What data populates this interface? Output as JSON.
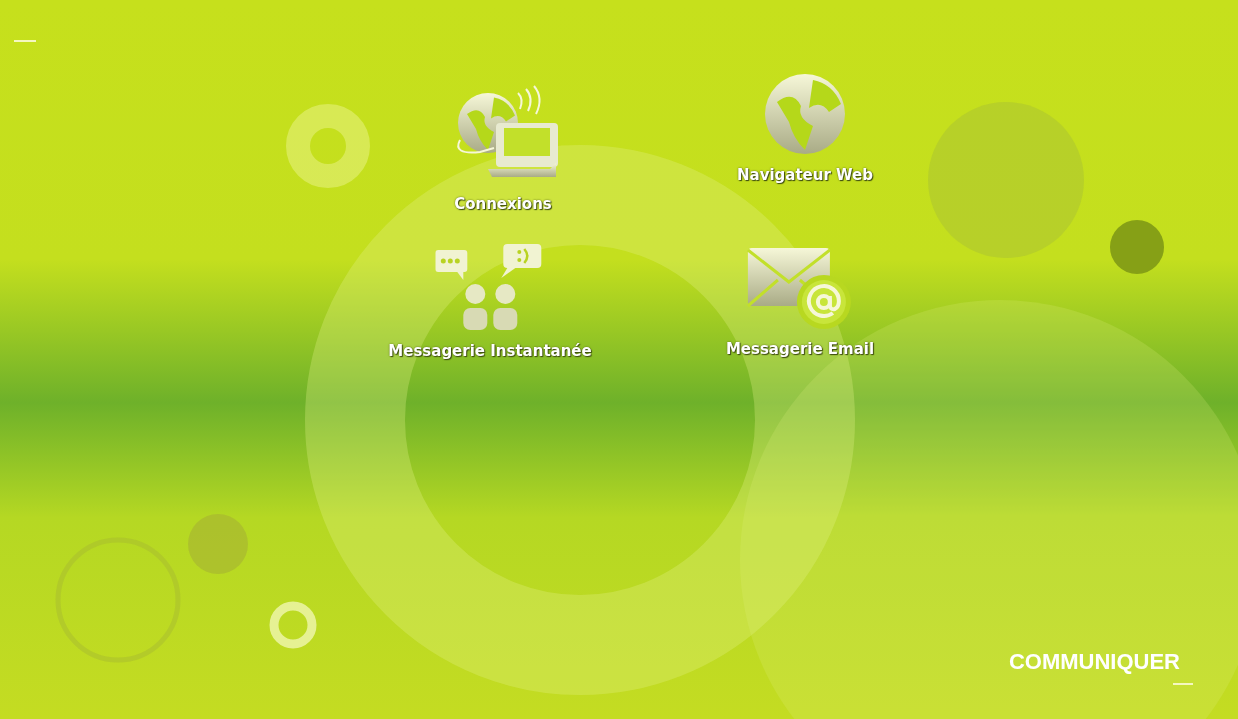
{
  "launchers": [
    {
      "kind": "connections",
      "label": "Connexions"
    },
    {
      "kind": "browser",
      "label": "Navigateur Web"
    },
    {
      "kind": "chat",
      "label": "Messagerie Instantanée"
    },
    {
      "kind": "email",
      "label": "Messagerie Email"
    }
  ],
  "section_title": "COMMUNIQUER"
}
